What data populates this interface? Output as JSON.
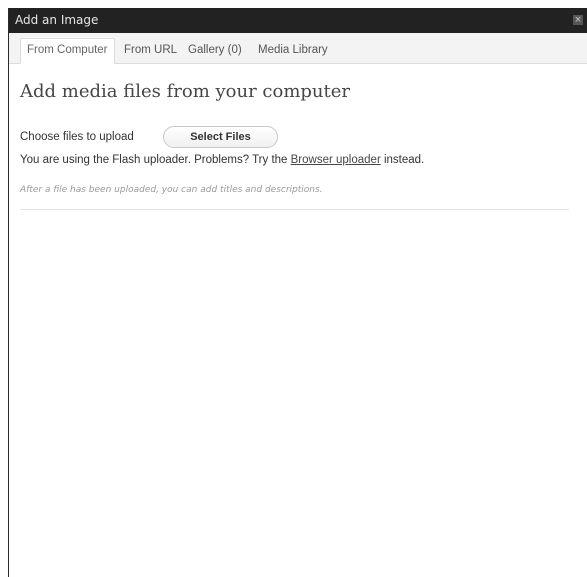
{
  "window": {
    "title": "Add an Image",
    "close_glyph": "×",
    "close_icon": "close-icon"
  },
  "tabs": [
    {
      "label": "From Computer",
      "active": true
    },
    {
      "label": "From URL",
      "active": false
    },
    {
      "label": "Gallery (0)",
      "active": false
    },
    {
      "label": "Media Library",
      "active": false
    }
  ],
  "content": {
    "heading": "Add media files from your computer",
    "choose_label": "Choose files to upload",
    "select_button": "Select Files",
    "flash_prefix": "You are using the Flash uploader.  Problems?  Try the ",
    "browser_link": "Browser uploader",
    "flash_suffix": " instead.",
    "note": "After a file has been uploaded, you can add titles and descriptions."
  }
}
